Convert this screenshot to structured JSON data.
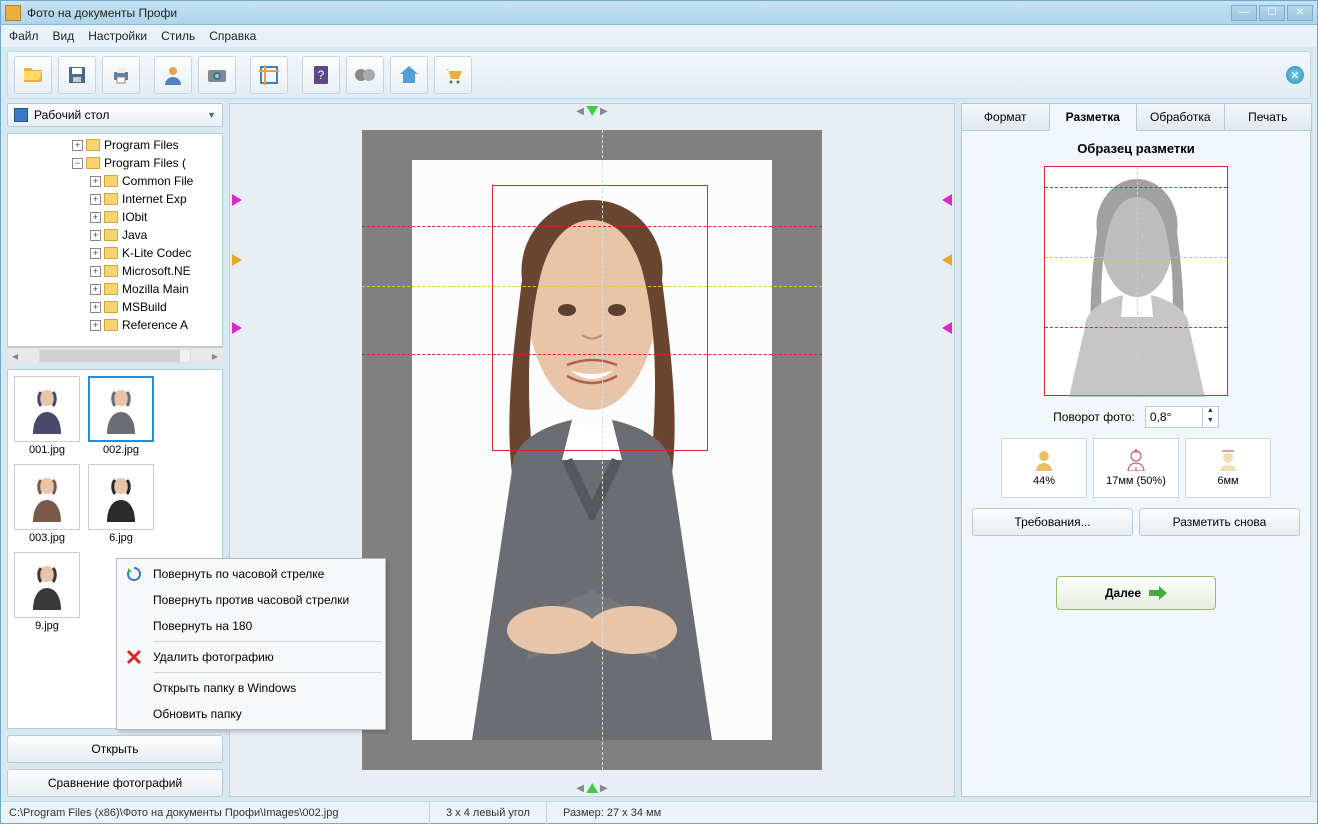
{
  "window": {
    "title": "Фото на документы Профи"
  },
  "menu": {
    "file": "Файл",
    "view": "Вид",
    "settings": "Настройки",
    "style": "Стиль",
    "help": "Справка"
  },
  "sidebar": {
    "combo": "Рабочий стол",
    "tree": [
      {
        "indent": 1,
        "exp": "+",
        "label": "Program Files"
      },
      {
        "indent": 1,
        "exp": "−",
        "label": "Program Files ("
      },
      {
        "indent": 2,
        "exp": "+",
        "label": "Common File"
      },
      {
        "indent": 2,
        "exp": "+",
        "label": "Internet Exp"
      },
      {
        "indent": 2,
        "exp": "+",
        "label": "IObit"
      },
      {
        "indent": 2,
        "exp": "+",
        "label": "Java"
      },
      {
        "indent": 2,
        "exp": "+",
        "label": "K-Lite Codec"
      },
      {
        "indent": 2,
        "exp": "+",
        "label": "Microsoft.NE"
      },
      {
        "indent": 2,
        "exp": "+",
        "label": "Mozilla Main"
      },
      {
        "indent": 2,
        "exp": "+",
        "label": "MSBuild"
      },
      {
        "indent": 2,
        "exp": "+",
        "label": "Reference A"
      }
    ],
    "thumbs": [
      {
        "name": "001.jpg",
        "selected": false
      },
      {
        "name": "002.jpg",
        "selected": true
      },
      {
        "name": "003.jpg",
        "selected": false
      },
      {
        "name": "6.jpg",
        "selected": false
      },
      {
        "name": "9.jpg",
        "selected": false
      }
    ],
    "open_btn": "Открыть",
    "compare_btn": "Сравнение фотографий"
  },
  "context_menu": {
    "rotate_cw": "Повернуть по часовой стрелке",
    "rotate_ccw": "Повернуть против часовой стрелки",
    "rotate_180": "Повернуть на 180",
    "delete": "Удалить фотографию",
    "open_folder": "Открыть папку в Windows",
    "refresh": "Обновить папку"
  },
  "rightpanel": {
    "tabs": {
      "format": "Формат",
      "markup": "Разметка",
      "process": "Обработка",
      "print": "Печать"
    },
    "sample_title": "Образец разметки",
    "rotate_label": "Поворот фото:",
    "rotate_value": "0,8°",
    "metric1": "44%",
    "metric2": "17мм (50%)",
    "metric3": "6мм",
    "requirements": "Требования...",
    "remark": "Разметить снова",
    "next": "Далее"
  },
  "status": {
    "path": "C:\\Program Files (x86)\\Фото на документы Профи\\Images\\002.jpg",
    "corner": "3 x 4 левый угол",
    "size": "Размер: 27 x 34 мм"
  }
}
